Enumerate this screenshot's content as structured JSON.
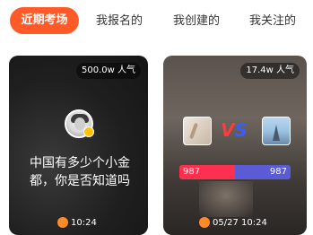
{
  "tabs": [
    {
      "label": "近期考场"
    },
    {
      "label": "我报名的"
    },
    {
      "label": "我创建的"
    },
    {
      "label": "我关注的"
    }
  ],
  "cards": [
    {
      "popularity": "500.0w 人气",
      "question": "中国有多少个小金都，你是否知道吗",
      "footer": "10:24"
    },
    {
      "popularity": "17.4w 人气",
      "vs_label_v": "V",
      "vs_label_s": "S",
      "left_votes": "987",
      "right_votes": "987",
      "left_share": 0.5,
      "footer": "05/27 10:24"
    }
  ],
  "colors": {
    "accent": "#ff5a28",
    "bar_left": "#ff2f4f",
    "bar_right": "#5b5bd6"
  }
}
